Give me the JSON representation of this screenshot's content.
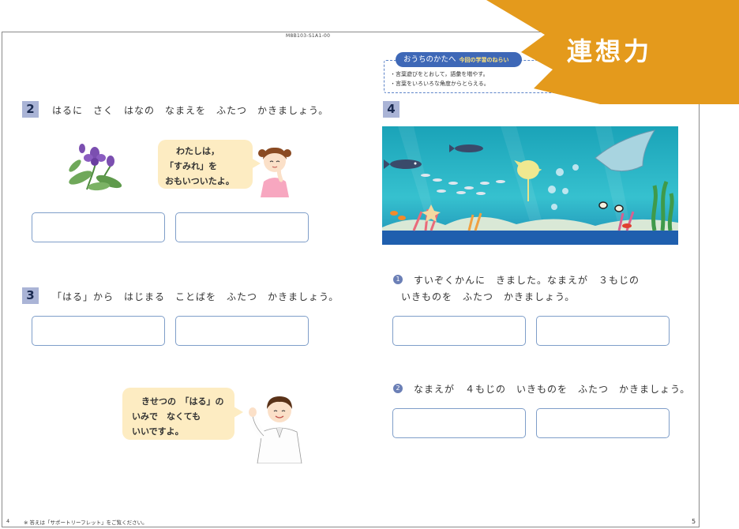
{
  "doc_code": "M8B103-S1A1-00",
  "banner": {
    "label": "連想力"
  },
  "parent_note": {
    "title": "おうちのかたへ",
    "subtitle": "今回の学習のねらい",
    "points": [
      "・言葉遊びをとおして，語彙を増やす。",
      "・言葉をいろいろな角度からとらえる。"
    ]
  },
  "q2": {
    "number": "2",
    "text": "はるに　さく　はなの　なまえを　ふたつ　かきましょう。",
    "bubble_lines": [
      "わたしは，",
      "「すみれ」を",
      "おもいついたよ。"
    ]
  },
  "q3": {
    "number": "3",
    "text": "「はる」から　はじまる　ことばを　ふたつ　かきましょう。",
    "bubble_lines": [
      "きせつの　「はる」の",
      "いみで　なくても",
      "いいですよ。"
    ]
  },
  "q4": {
    "number": "4",
    "sub1_num": "1",
    "sub1_line1": "すいぞくかんに　きました。なまえが　３もじの",
    "sub1_line2": "いきものを　ふたつ　かきましょう。",
    "sub2_num": "2",
    "sub2_text": "なまえが　４もじの　いきものを　ふたつ　かきましょう。"
  },
  "footer": {
    "left_page": "4",
    "note": "※ 答えは「サポートリーフレット」をご覧ください。",
    "right_page": "5"
  },
  "colors": {
    "accent_orange": "#e49a1c",
    "box_blue": "#7f9ec9",
    "bubble_yellow": "#fdecc2",
    "qnum_bg": "#aab4d6",
    "sea": "#2bb5c6"
  }
}
